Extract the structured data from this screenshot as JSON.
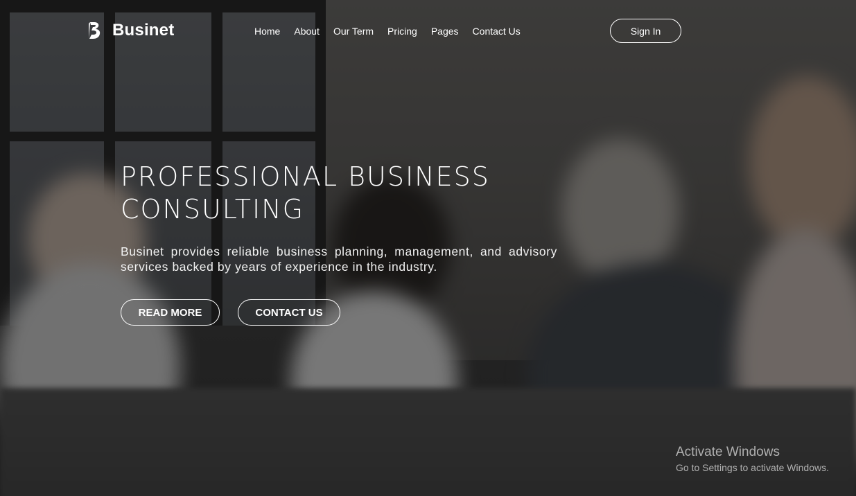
{
  "brand": {
    "name": "Businet",
    "logo_icon": "b-letter-logo-icon"
  },
  "nav": {
    "items": [
      {
        "label": "Home"
      },
      {
        "label": "About"
      },
      {
        "label": "Our Term"
      },
      {
        "label": "Pricing"
      },
      {
        "label": "Pages"
      },
      {
        "label": "Contact Us"
      }
    ],
    "signin_label": "Sign In"
  },
  "hero": {
    "title_line1": "PROFESSIONAL BUSINESS",
    "title_line2": "CONSULTING",
    "description": "Businet provides reliable business planning, management, and advisory services backed by years of experience in the industry.",
    "read_more_label": "READ MORE",
    "contact_label": "CONTACT US"
  },
  "watermark": {
    "title": "Activate Windows",
    "subtitle": "Go to Settings to activate Windows."
  },
  "colors": {
    "overlay": "#141414",
    "text": "#ffffff"
  }
}
